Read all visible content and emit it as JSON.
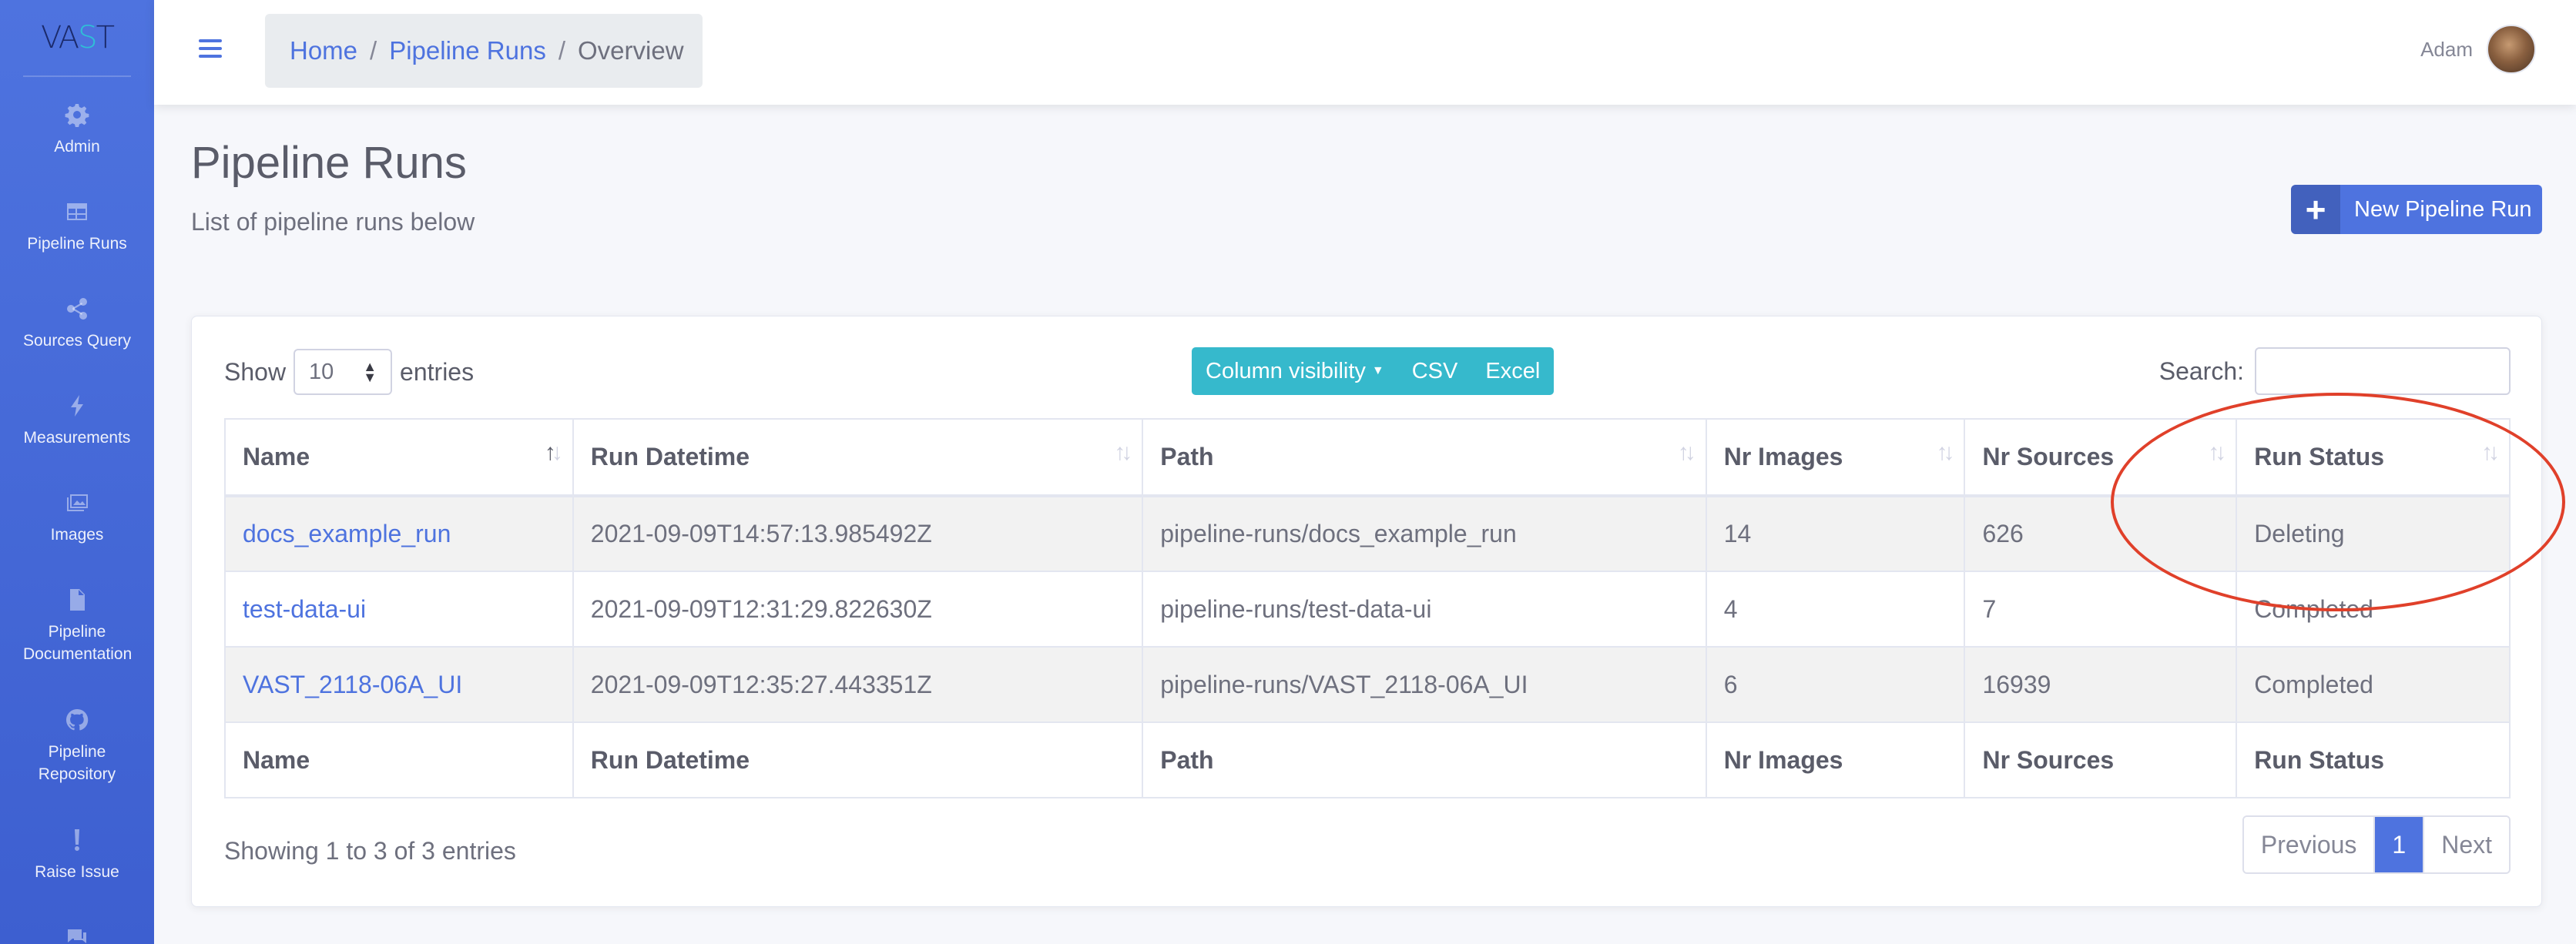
{
  "brand": {
    "prefix": "VA",
    "accent": "S",
    "suffix": "T"
  },
  "sidebar": {
    "items": [
      {
        "label": "Admin",
        "icon": "gear-icon"
      },
      {
        "label": "Pipeline Runs",
        "icon": "table-icon"
      },
      {
        "label": "Sources Query",
        "icon": "share-icon"
      },
      {
        "label": "Measurements",
        "icon": "bolt-icon"
      },
      {
        "label": "Images",
        "icon": "images-icon"
      },
      {
        "label": "Pipeline Documentation",
        "icon": "file-icon"
      },
      {
        "label": "Pipeline Repository",
        "icon": "github-icon"
      },
      {
        "label": "Raise Issue",
        "icon": "exclamation-icon"
      }
    ]
  },
  "breadcrumb": {
    "home": "Home",
    "runs": "Pipeline Runs",
    "current": "Overview",
    "separator": "/"
  },
  "user": {
    "name": "Adam"
  },
  "page": {
    "title": "Pipeline Runs",
    "subtitle": "List of pipeline runs below"
  },
  "new_run_button": {
    "label": "New Pipeline Run",
    "icon": "plus-icon"
  },
  "table_controls": {
    "show_label": "Show",
    "length_value": "10",
    "entries_label": "entries",
    "column_visibility": "Column visibility",
    "csv": "CSV",
    "excel": "Excel",
    "search_label": "Search:",
    "search_value": ""
  },
  "table": {
    "columns": [
      "Name",
      "Run Datetime",
      "Path",
      "Nr Images",
      "Nr Sources",
      "Run Status"
    ],
    "rows": [
      {
        "name": "docs_example_run",
        "datetime": "2021-09-09T14:57:13.985492Z",
        "path": "pipeline-runs/docs_example_run",
        "images": "14",
        "sources": "626",
        "status": "Deleting"
      },
      {
        "name": "test-data-ui",
        "datetime": "2021-09-09T12:31:29.822630Z",
        "path": "pipeline-runs/test-data-ui",
        "images": "4",
        "sources": "7",
        "status": "Completed"
      },
      {
        "name": "VAST_2118-06A_UI",
        "datetime": "2021-09-09T12:35:27.443351Z",
        "path": "pipeline-runs/VAST_2118-06A_UI",
        "images": "6",
        "sources": "16939",
        "status": "Completed"
      }
    ]
  },
  "footer": {
    "info": "Showing 1 to 3 of 3 entries",
    "previous": "Previous",
    "page": "1",
    "next": "Next"
  },
  "colors": {
    "primary": "#4e73df",
    "info": "#36b9cc",
    "annotation": "#e0402a"
  }
}
